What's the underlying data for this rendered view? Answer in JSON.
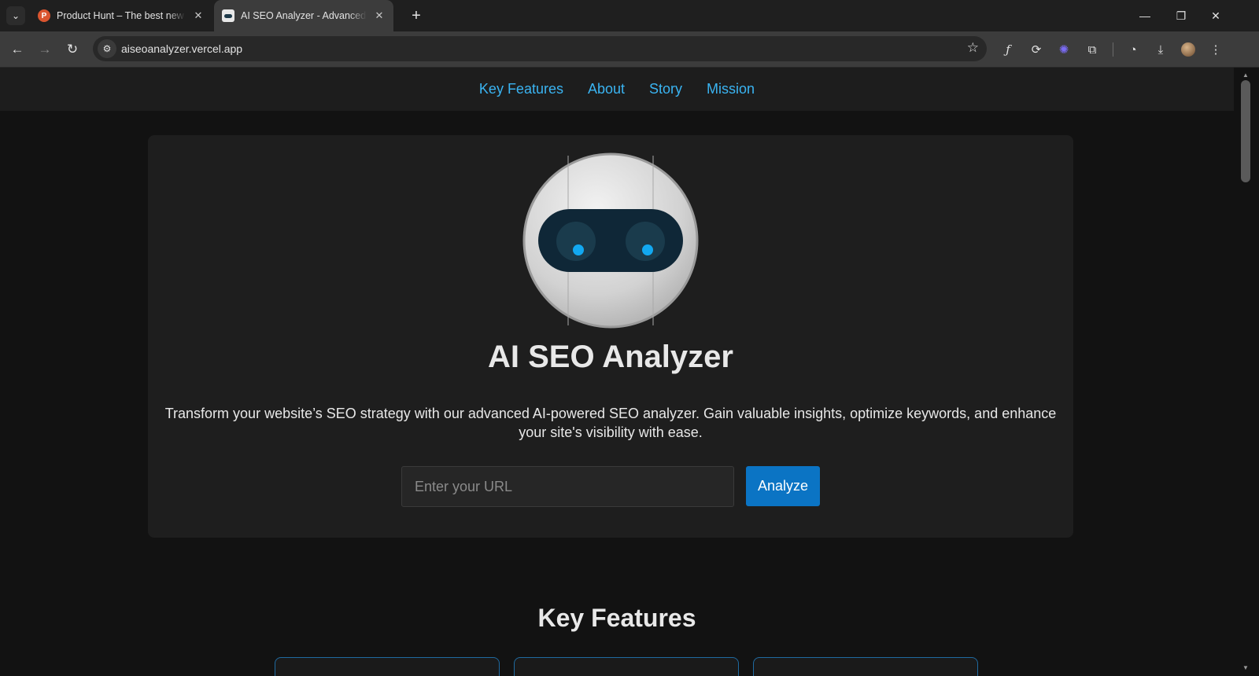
{
  "browser": {
    "tabs": [
      {
        "title": "Product Hunt – The best new products in tech",
        "favicon": "P",
        "favicon_color": "#da552f",
        "active": false
      },
      {
        "title": "AI SEO Analyzer - Advanced AI SEO Tool",
        "active": true
      }
    ],
    "new_tab_symbol": "+",
    "address": "aiseoanalyzer.vercel.app",
    "window_controls": {
      "minimize": "—",
      "restore": "❐",
      "close": "✕"
    }
  },
  "nav": {
    "links": [
      "Key Features",
      "About",
      "Story",
      "Mission"
    ],
    "link_color": "#3ab4f2"
  },
  "hero": {
    "title": "AI SEO Analyzer",
    "description": "Transform your website’s SEO strategy with our advanced AI-powered SEO analyzer. Gain valuable insights, optimize keywords, and enhance your site's visibility with ease.",
    "input_placeholder": "Enter your URL",
    "button_label": "Analyze",
    "accent_color": "#0b74c4"
  },
  "features": {
    "title": "Key Features"
  }
}
